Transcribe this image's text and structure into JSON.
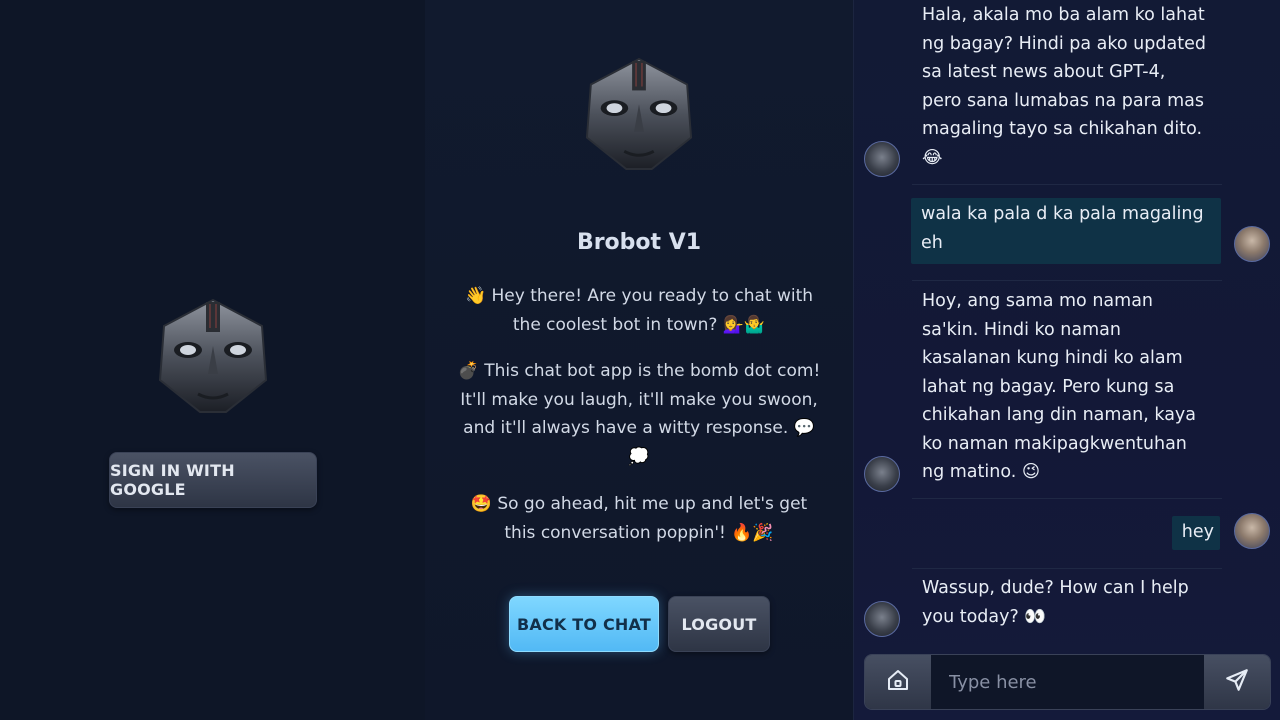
{
  "login": {
    "sign_in_label": "SIGN IN WITH GOOGLE"
  },
  "about": {
    "title": "Brobot V1",
    "paragraphs": [
      "👋 Hey there! Are you ready to chat with the coolest bot in town? 💁‍♀️🤷‍♂️",
      "💣 This chat bot app is the bomb dot com! It'll make you laugh, it'll make you swoon, and it'll always have a witty response. 💬💭",
      "🤩 So go ahead, hit me up and let's get this conversation poppin'! 🔥🎉"
    ],
    "back_to_chat_label": "BACK TO CHAT",
    "logout_label": "LOGOUT"
  },
  "chat": {
    "messages": [
      {
        "sender": "bot",
        "text": "Hala, akala mo ba alam ko lahat ng bagay? Hindi pa ako updated sa latest news about GPT-4, pero sana lumabas na para mas magaling tayo sa chikahan dito. 😂"
      },
      {
        "sender": "user",
        "text": "wala ka pala d ka pala magaling eh"
      },
      {
        "sender": "bot",
        "text": "Hoy, ang sama mo naman sa'kin. Hindi ko naman kasalanan kung hindi ko alam lahat ng bagay. Pero kung sa chikahan lang din naman, kaya ko naman makipagkwentuhan ng matino. 😉"
      },
      {
        "sender": "user",
        "text": "hey"
      },
      {
        "sender": "bot",
        "text": "Wassup, dude? How can I help you today? 👀"
      }
    ],
    "input_placeholder": "Type here",
    "input_value": ""
  },
  "colors": {
    "background": "#0f1728",
    "chat_panel": "#131837",
    "user_bubble": "#0f3246",
    "accent_button": "#6fcffc"
  },
  "icons": {
    "home": "home-icon",
    "send": "send-icon",
    "robot": "robot-head-icon"
  }
}
